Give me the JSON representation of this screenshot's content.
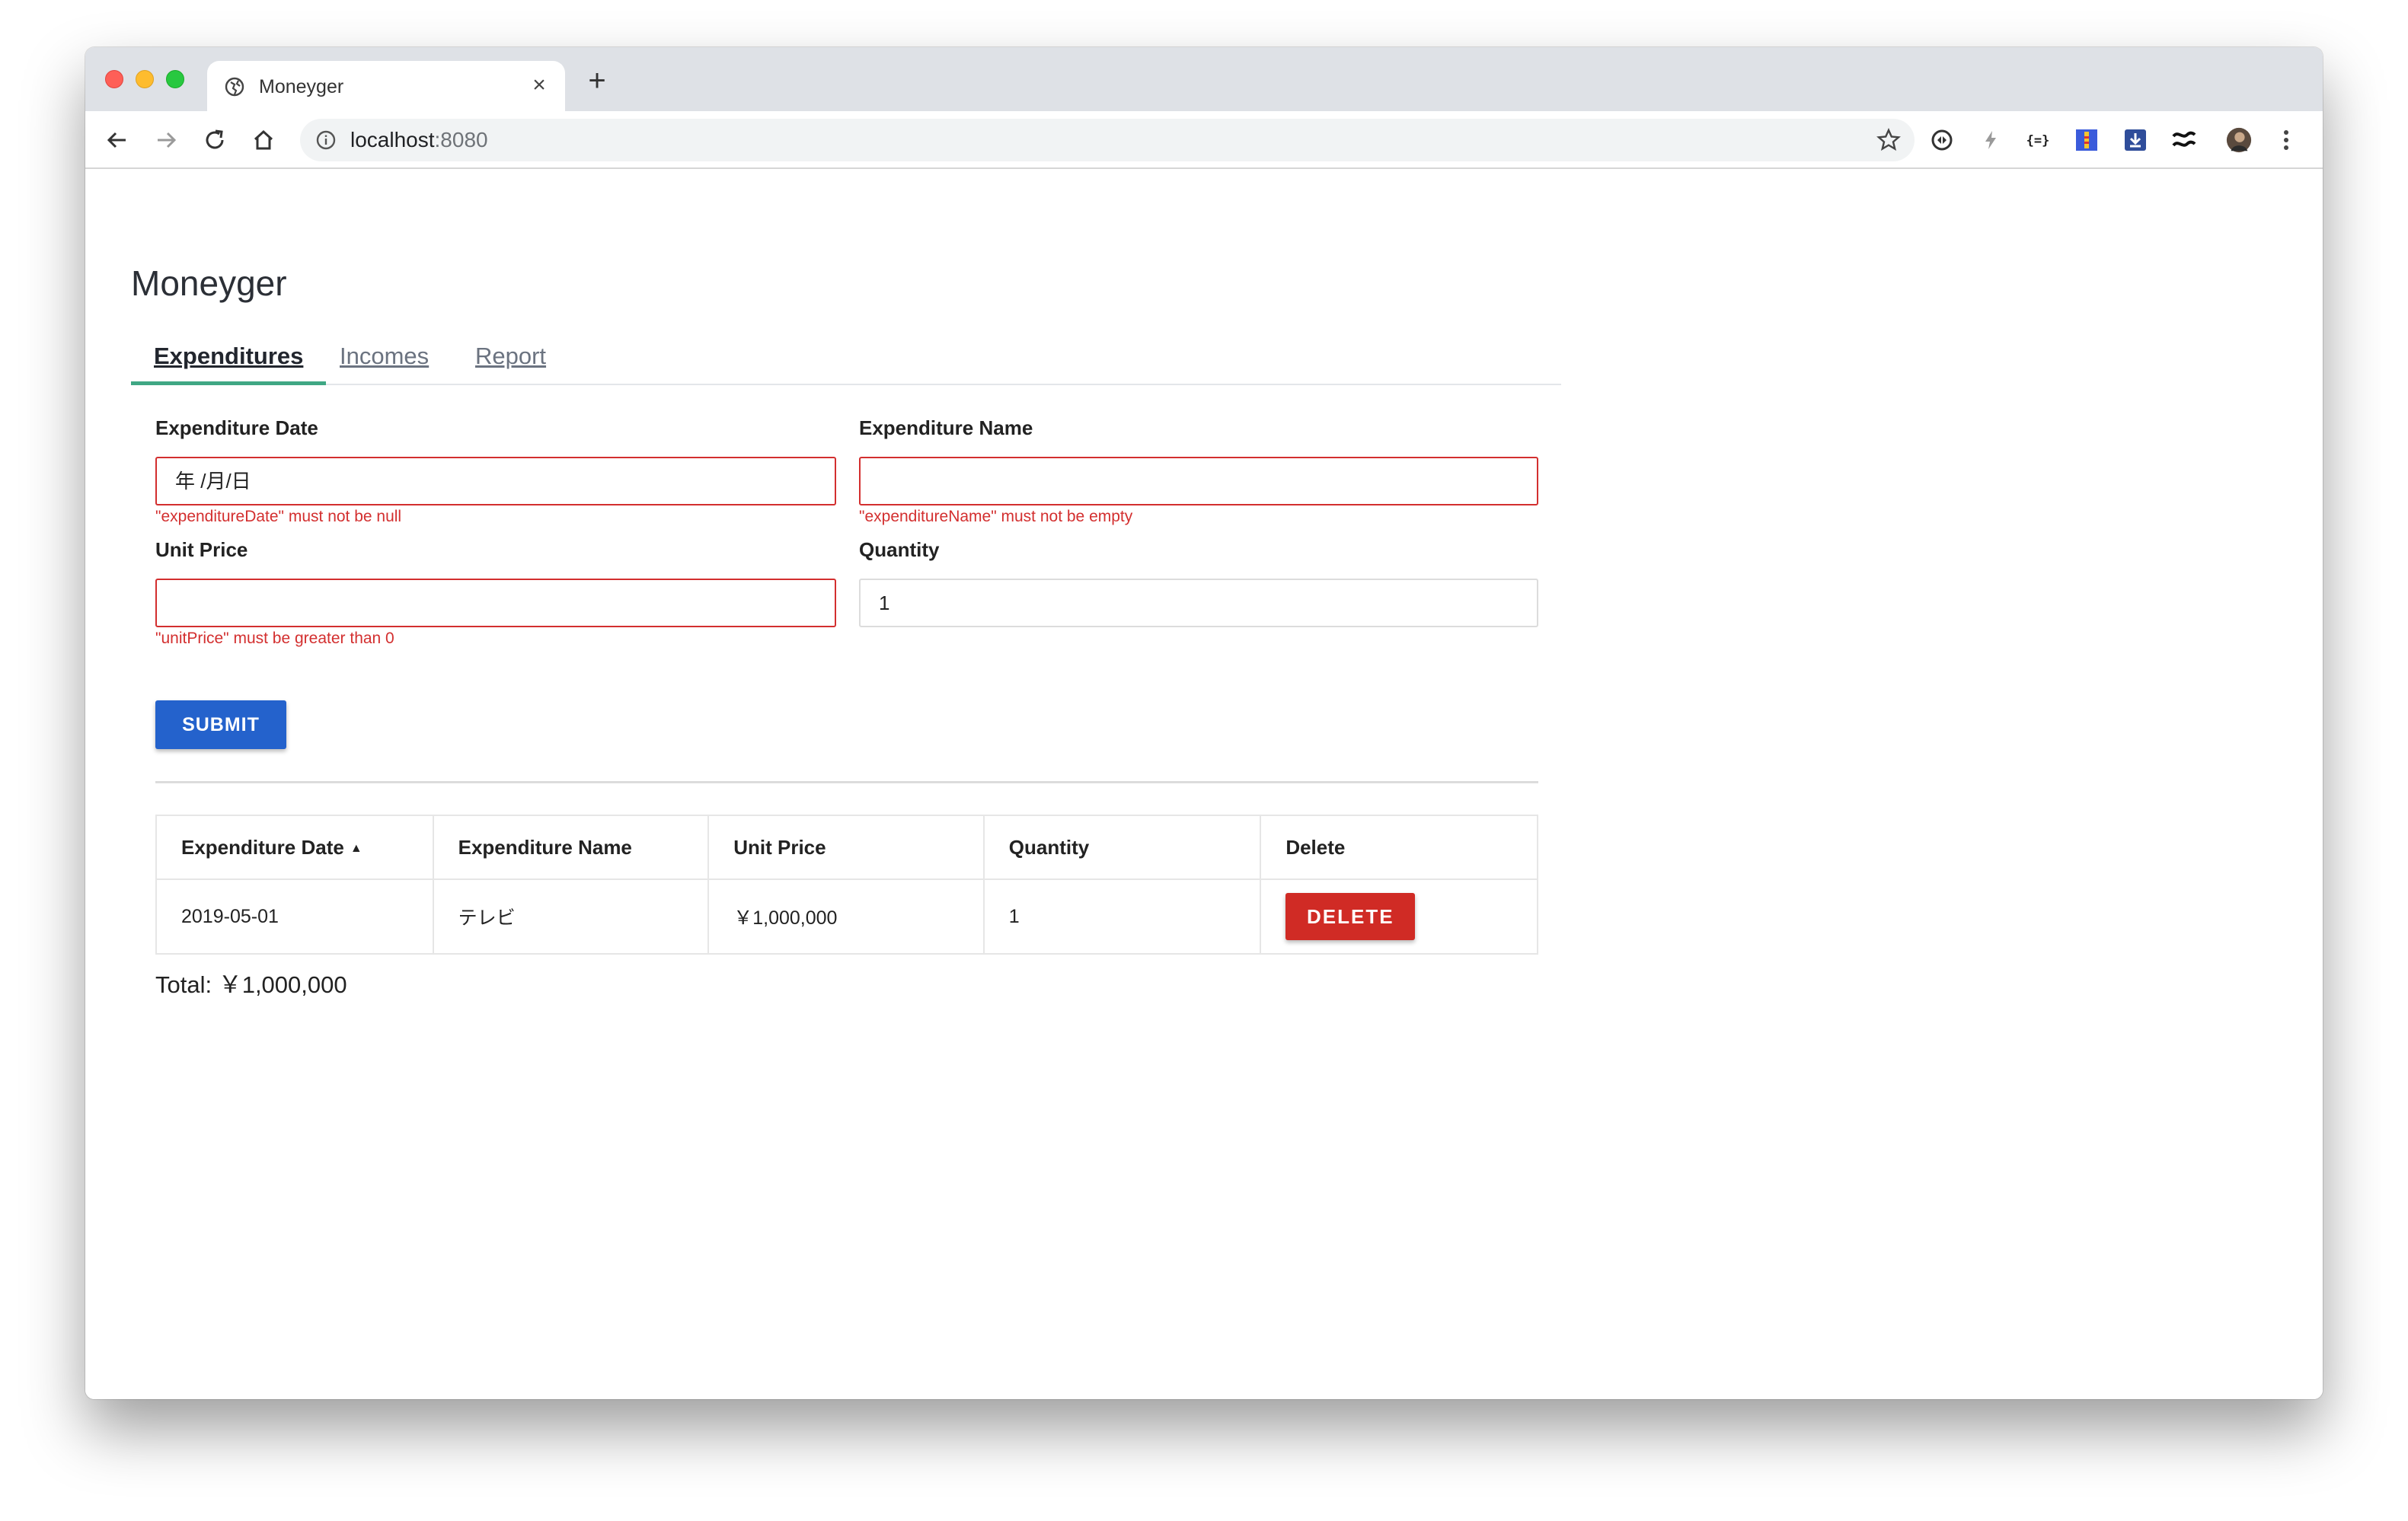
{
  "browser": {
    "tab_title": "Moneyger",
    "tab_close": "×",
    "new_tab": "+",
    "url_host": "localhost",
    "url_port": ":8080"
  },
  "app": {
    "title": "Moneyger",
    "tabs": [
      {
        "label": "Expenditures",
        "active": true
      },
      {
        "label": "Incomes",
        "active": false
      },
      {
        "label": "Report",
        "active": false
      }
    ]
  },
  "form": {
    "expenditure_date": {
      "label": "Expenditure Date",
      "placeholder": "年 /月/日",
      "error": "\"expenditureDate\" must not be null"
    },
    "expenditure_name": {
      "label": "Expenditure Name",
      "value": "",
      "error": "\"expenditureName\" must not be empty"
    },
    "unit_price": {
      "label": "Unit Price",
      "value": "",
      "error": "\"unitPrice\" must be greater than 0"
    },
    "quantity": {
      "label": "Quantity",
      "value": "1"
    },
    "submit_label": "SUBMIT"
  },
  "table": {
    "headers": [
      "Expenditure Date",
      "Expenditure Name",
      "Unit Price",
      "Quantity",
      "Delete"
    ],
    "sort_indicator": "▲",
    "rows": [
      {
        "date": "2019-05-01",
        "name": "テレビ",
        "unit_price": "￥1,000,000",
        "quantity": "1",
        "delete_label": "DELETE"
      }
    ]
  },
  "total": "Total: ￥1,000,000",
  "colors": {
    "accent_tab": "#3fa784",
    "submit": "#2462cc",
    "delete": "#d02b25",
    "error": "#d32f2f"
  }
}
